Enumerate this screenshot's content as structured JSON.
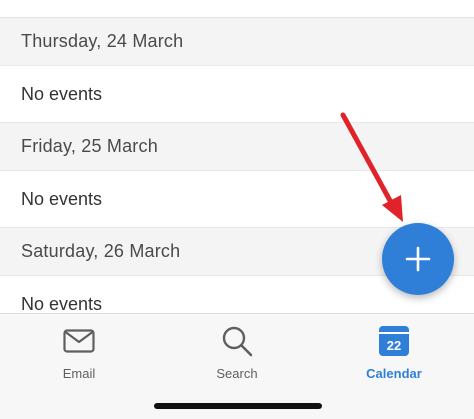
{
  "agenda": {
    "days": [
      {
        "date": "Thursday, 24 March",
        "events_text": "No events"
      },
      {
        "date": "Friday, 25 March",
        "events_text": "No events"
      },
      {
        "date": "Saturday, 26 March",
        "events_text": "No events"
      }
    ]
  },
  "fab": {
    "icon": "plus-icon",
    "color": "#2f7fd8"
  },
  "annotation": {
    "icon": "red-arrow-icon",
    "color": "#e0232a"
  },
  "tabbar": {
    "tabs": [
      {
        "label": "Email",
        "icon": "envelope-icon",
        "active": false
      },
      {
        "label": "Search",
        "icon": "magnifier-icon",
        "active": false
      },
      {
        "label": "Calendar",
        "icon": "calendar-icon",
        "active": true,
        "calendar_day": "22"
      }
    ]
  },
  "colors": {
    "accent": "#2f7fd8",
    "header_bg": "#f4f4f4"
  }
}
